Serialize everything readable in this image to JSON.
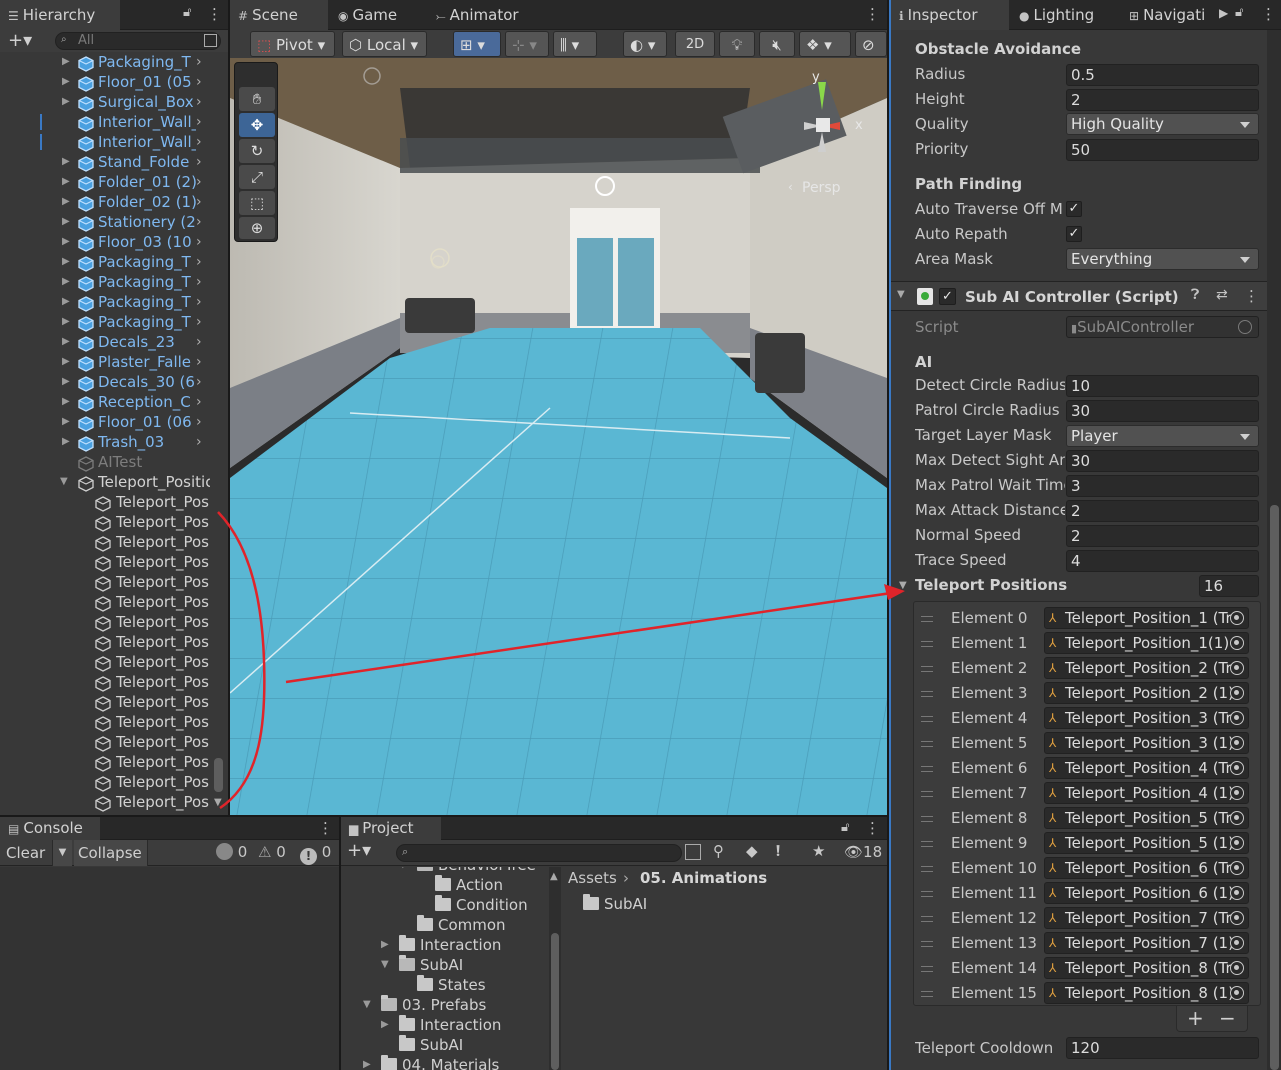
{
  "hierarchy": {
    "tab_label": "Hierarchy",
    "search_placeholder": "All",
    "items": [
      {
        "label": "Packaging_T",
        "kind": "prefab"
      },
      {
        "label": "Floor_01 (05",
        "kind": "prefab"
      },
      {
        "label": "Surgical_Box",
        "kind": "prefab"
      },
      {
        "label": "Interior_Wall_",
        "kind": "prefab"
      },
      {
        "label": "Interior_Wall_",
        "kind": "prefab"
      },
      {
        "label": "Stand_Folde",
        "kind": "prefab"
      },
      {
        "label": "Folder_01 (2)",
        "kind": "prefab"
      },
      {
        "label": "Folder_02 (1)",
        "kind": "prefab"
      },
      {
        "label": "Stationery (2",
        "kind": "prefab"
      },
      {
        "label": "Floor_03 (10",
        "kind": "prefab"
      },
      {
        "label": "Packaging_T",
        "kind": "prefab"
      },
      {
        "label": "Packaging_T",
        "kind": "prefab"
      },
      {
        "label": "Packaging_T",
        "kind": "prefab"
      },
      {
        "label": "Packaging_T",
        "kind": "prefab"
      },
      {
        "label": "Decals_23",
        "kind": "prefab"
      },
      {
        "label": "Plaster_Falle",
        "kind": "prefab"
      },
      {
        "label": "Decals_30 (6",
        "kind": "prefab"
      },
      {
        "label": "Reception_C",
        "kind": "prefab"
      },
      {
        "label": "Floor_01 (06",
        "kind": "prefab"
      },
      {
        "label": "Trash_03",
        "kind": "prefab"
      },
      {
        "label": "AITest",
        "kind": "disabled"
      },
      {
        "label": "Teleport_Positic",
        "kind": "parent"
      }
    ],
    "child_label": "Teleport_Pos",
    "child_count": 16
  },
  "scene": {
    "tabs": [
      "Scene",
      "Game",
      "Animator"
    ],
    "pivot_label": "Pivot",
    "local_label": "Local",
    "mode_2d": "2D",
    "persp_label": "Persp",
    "gizmo_y": "y",
    "gizmo_x": "x"
  },
  "inspector": {
    "tabs": [
      "Inspector",
      "Lighting",
      "Navigati"
    ],
    "obstacle": {
      "title": "Obstacle Avoidance",
      "radius_label": "Radius",
      "radius": "0.5",
      "height_label": "Height",
      "height": "2",
      "quality_label": "Quality",
      "quality": "High Quality",
      "priority_label": "Priority",
      "priority": "50"
    },
    "pathfinding": {
      "title": "Path Finding",
      "auto_traverse_label": "Auto Traverse Off Me",
      "auto_repath_label": "Auto Repath",
      "area_mask_label": "Area Mask",
      "area_mask": "Everything"
    },
    "component_title": "Sub AI Controller (Script)",
    "script_label": "Script",
    "script_value": "SubAIController",
    "ai": {
      "title": "AI",
      "fields": [
        {
          "label": "Detect Circle Radius",
          "value": "10",
          "type": "field"
        },
        {
          "label": "Patrol Circle Radius",
          "value": "30",
          "type": "field"
        },
        {
          "label": "Target Layer Mask",
          "value": "Player",
          "type": "drop"
        },
        {
          "label": "Max Detect Sight An",
          "value": "30",
          "type": "field"
        },
        {
          "label": "Max Patrol Wait Time",
          "value": "3",
          "type": "field"
        },
        {
          "label": "Max Attack Distance",
          "value": "2",
          "type": "field"
        },
        {
          "label": "Normal Speed",
          "value": "2",
          "type": "field"
        },
        {
          "label": "Trace Speed",
          "value": "4",
          "type": "field"
        }
      ]
    },
    "teleport": {
      "title": "Teleport Positions",
      "count": "16",
      "elements": [
        {
          "label": "Element 0",
          "value": "Teleport_Position_1 (Tr"
        },
        {
          "label": "Element 1",
          "value": "Teleport_Position_1(1) ("
        },
        {
          "label": "Element 2",
          "value": "Teleport_Position_2 (Tr"
        },
        {
          "label": "Element 3",
          "value": "Teleport_Position_2 (1)"
        },
        {
          "label": "Element 4",
          "value": "Teleport_Position_3 (Tr"
        },
        {
          "label": "Element 5",
          "value": "Teleport_Position_3 (1)"
        },
        {
          "label": "Element 6",
          "value": "Teleport_Position_4 (Tr"
        },
        {
          "label": "Element 7",
          "value": "Teleport_Position_4 (1)"
        },
        {
          "label": "Element 8",
          "value": "Teleport_Position_5 (Tr"
        },
        {
          "label": "Element 9",
          "value": "Teleport_Position_5 (1)"
        },
        {
          "label": "Element 10",
          "value": "Teleport_Position_6 (Tr"
        },
        {
          "label": "Element 11",
          "value": "Teleport_Position_6 (1)"
        },
        {
          "label": "Element 12",
          "value": "Teleport_Position_7 (Tr"
        },
        {
          "label": "Element 13",
          "value": "Teleport_Position_7 (1)"
        },
        {
          "label": "Element 14",
          "value": "Teleport_Position_8 (Tr"
        },
        {
          "label": "Element 15",
          "value": "Teleport_Position_8 (1)"
        }
      ],
      "add_label": "+",
      "remove_label": "−"
    },
    "cooldown_label": "Teleport Cooldown",
    "cooldown": "120"
  },
  "console": {
    "tab_label": "Console",
    "clear_label": "Clear",
    "collapse_label": "Collapse",
    "info_count": "0",
    "warn_count": "0",
    "error_count": "0"
  },
  "project": {
    "tab_label": "Project",
    "hidden_count": "18",
    "tree": [
      {
        "label": "BehaviorTree",
        "depth": 3,
        "arrow": "down",
        "cut": true
      },
      {
        "label": "Action",
        "depth": 4,
        "arrow": ""
      },
      {
        "label": "Condition",
        "depth": 4,
        "arrow": ""
      },
      {
        "label": "Common",
        "depth": 3,
        "arrow": ""
      },
      {
        "label": "Interaction",
        "depth": 2,
        "arrow": "right"
      },
      {
        "label": "SubAI",
        "depth": 2,
        "arrow": "down"
      },
      {
        "label": "States",
        "depth": 3,
        "arrow": ""
      },
      {
        "label": "03. Prefabs",
        "depth": 1,
        "arrow": "down"
      },
      {
        "label": "Interaction",
        "depth": 2,
        "arrow": "right"
      },
      {
        "label": "SubAI",
        "depth": 2,
        "arrow": ""
      },
      {
        "label": "04. Materials",
        "depth": 1,
        "arrow": "right"
      }
    ],
    "breadcrumb_root": "Assets",
    "breadcrumb_current": "05. Animations",
    "files": [
      "SubAI"
    ]
  },
  "colors": {
    "annotation": "#e0242a",
    "floor": "#5ab7d3",
    "link": "#7fb8f0"
  }
}
